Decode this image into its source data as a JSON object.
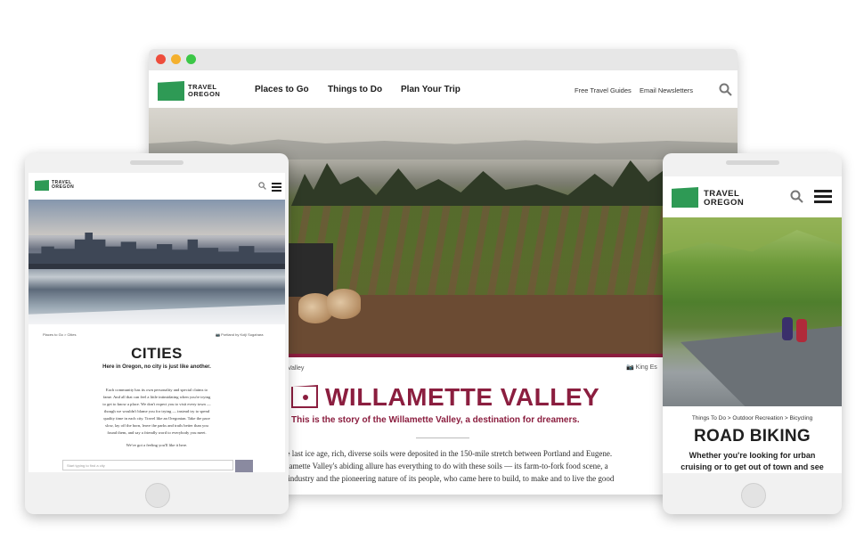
{
  "colors": {
    "brand_green": "#2e9a55",
    "accent_burgundy": "#8b1e3f"
  },
  "desktop": {
    "logo": {
      "line1": "TRAVEL",
      "line2": "OREGON"
    },
    "nav": [
      "Places to Go",
      "Things to Do",
      "Plan Your Trip"
    ],
    "utility": [
      "Free Travel Guides",
      "Email Newsletters"
    ],
    "icons": {
      "search": "search-icon"
    },
    "breadcrumb": "e Valley",
    "photo_credit": "King Es",
    "title": "WILLAMETTE VALLEY",
    "subtitle": "This is the story of the Willamette Valley, a destination for dreamers.",
    "body": [
      "he last ice age, rich, diverse soils were deposited in the 150-mile stretch between Portland and Eugene.",
      "illamette Valley's abiding allure has everything to do with these soils — its farm-to-fork food scene, a",
      "e industry and the pioneering nature of its people, who came here to build, to make and to live the good"
    ]
  },
  "phone_left": {
    "logo": {
      "line1": "TRAVEL",
      "line2": "OREGON"
    },
    "breadcrumb": "Places to Go  >  Cities",
    "photo_credit": "Portland by Koiji Sugahara",
    "title": "CITIES",
    "subtitle": "Here in Oregon, no city is just like another.",
    "body": [
      "Each community has its own personality and special claims to",
      "fame. And all that can feel a little intimidating when you're trying",
      "to get to know a place. We don't expect you to visit every town —",
      "though we wouldn't blame you for trying — instead try to spend",
      "quality time in each city. Travel like an Oregonian. Take the pace",
      "slow, lay off the horn, leave the parks and trails better than you",
      "found them, and say a friendly word to everybody you meet."
    ],
    "feeling": "We've got a feeling you'll like it here.",
    "input_placeholder": "Start typing to find a city"
  },
  "phone_right": {
    "logo": {
      "line1": "TRAVEL",
      "line2": "OREGON"
    },
    "breadcrumb": "Things To Do  >  Outdoor Recreation  >  Bicycling",
    "title": "ROAD BIKING",
    "subtitle": [
      "Whether you're looking for urban",
      "cruising or to get out of town and see"
    ]
  }
}
